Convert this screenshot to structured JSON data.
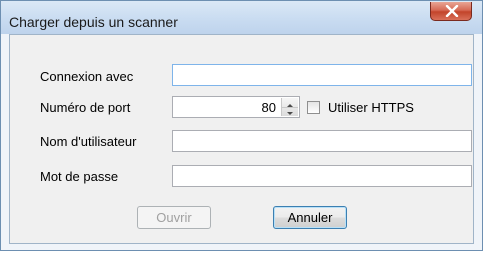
{
  "window": {
    "title": "Charger depuis un scanner",
    "close_symbol": "x"
  },
  "form": {
    "connection_label": "Connexion avec",
    "connection_value": "",
    "port_label": "Numéro de port",
    "port_value": "80",
    "https_label": "Utiliser HTTPS",
    "https_checked": false,
    "username_label": "Nom d'utilisateur",
    "username_value": "",
    "password_label": "Mot de passe",
    "password_value": ""
  },
  "buttons": {
    "open_label": "Ouvrir",
    "open_enabled": false,
    "cancel_label": "Annuler"
  },
  "colors": {
    "close_button": "#c2442a",
    "focus_border": "#7eb4ea"
  }
}
